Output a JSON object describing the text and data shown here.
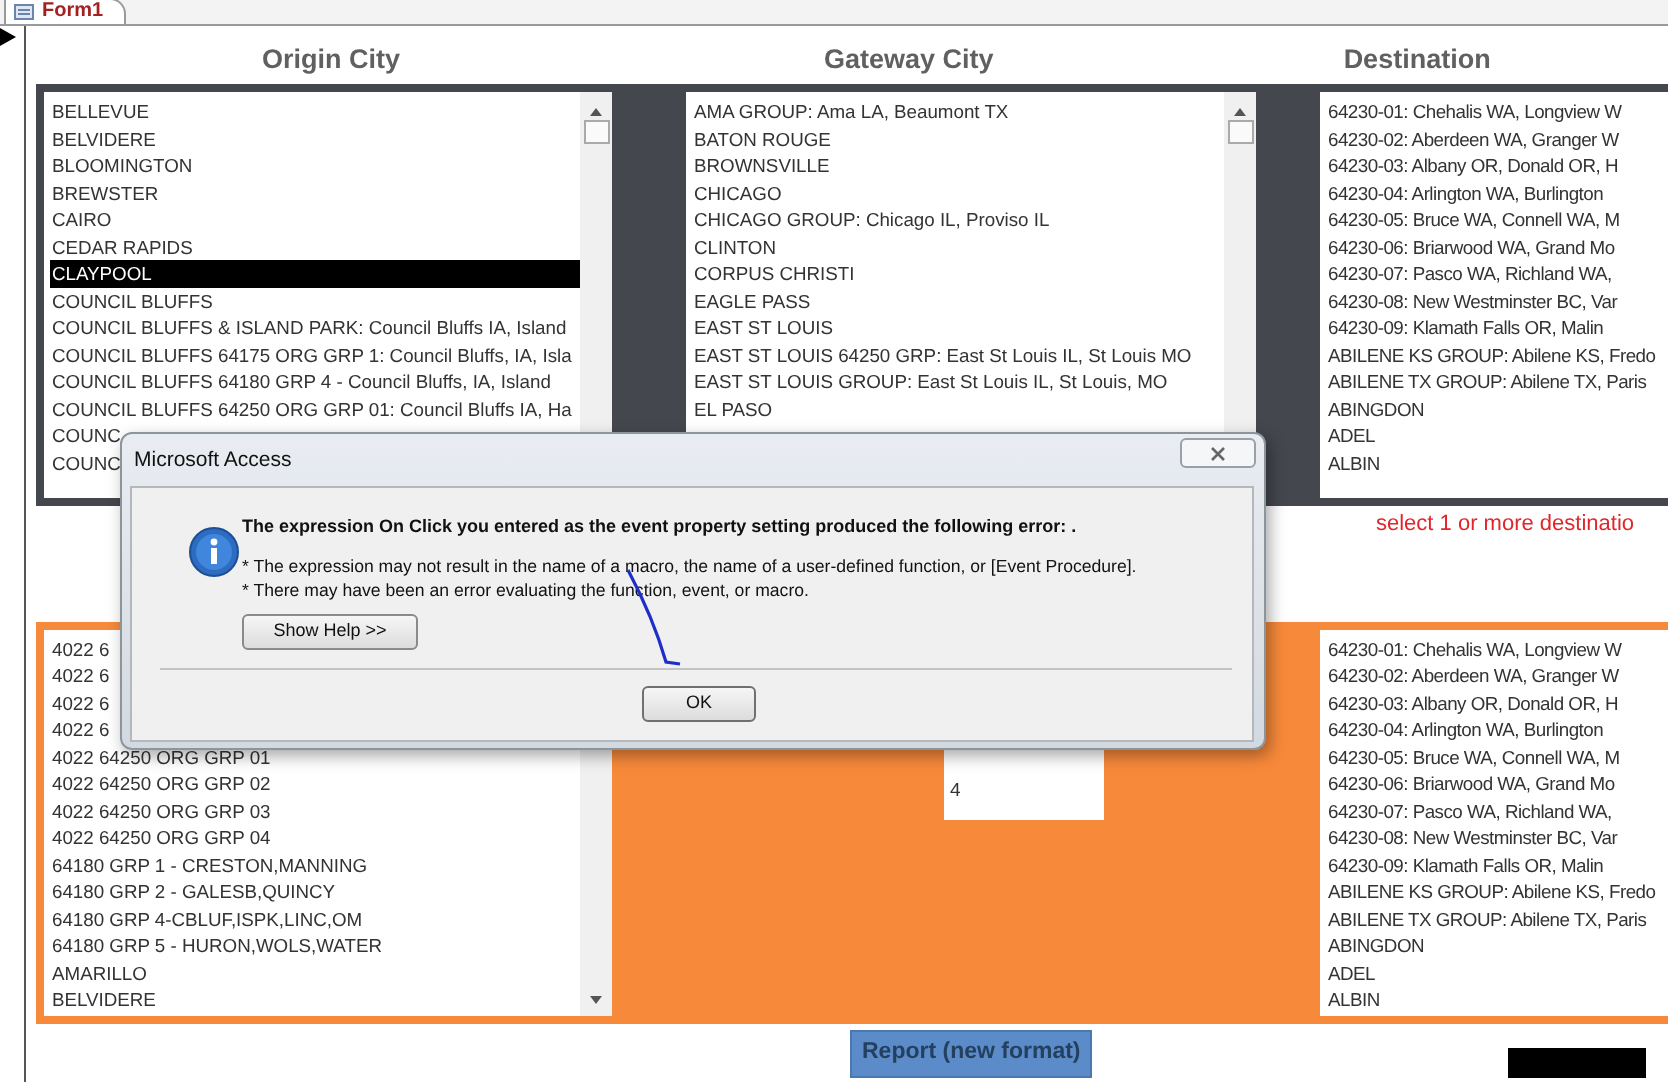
{
  "tab": {
    "label": "Form1"
  },
  "headers": [
    "Origin City",
    "Gateway City",
    "Destination"
  ],
  "origin_list": {
    "items": [
      {
        "text": "BELLEVUE",
        "selected": false
      },
      {
        "text": "BELVIDERE",
        "selected": false
      },
      {
        "text": "BLOOMINGTON",
        "selected": false
      },
      {
        "text": "BREWSTER",
        "selected": false
      },
      {
        "text": "CAIRO",
        "selected": false
      },
      {
        "text": "CEDAR RAPIDS",
        "selected": false
      },
      {
        "text": "CLAYPOOL",
        "selected": true
      },
      {
        "text": "COUNCIL BLUFFS",
        "selected": false
      },
      {
        "text": "COUNCIL BLUFFS & ISLAND PARK: Council Bluffs IA, Island",
        "selected": false
      },
      {
        "text": "COUNCIL BLUFFS 64175 ORG GRP 1: Council Bluffs, IA, Isla",
        "selected": false
      },
      {
        "text": "COUNCIL BLUFFS 64180 GRP 4 - Council Bluffs, IA, Island",
        "selected": false
      },
      {
        "text": "COUNCIL BLUFFS 64250 ORG GRP 01: Council Bluffs IA, Ha",
        "selected": false
      },
      {
        "text": "COUNC",
        "selected": false
      },
      {
        "text": "COUNC",
        "selected": false
      }
    ]
  },
  "gateway_list": {
    "items": [
      {
        "text": "AMA GROUP: Ama LA, Beaumont TX",
        "selected": false
      },
      {
        "text": "BATON ROUGE",
        "selected": false
      },
      {
        "text": "BROWNSVILLE",
        "selected": false
      },
      {
        "text": "CHICAGO",
        "selected": false
      },
      {
        "text": "CHICAGO GROUP: Chicago IL, Proviso IL",
        "selected": false
      },
      {
        "text": "CLINTON",
        "selected": false
      },
      {
        "text": "CORPUS CHRISTI",
        "selected": false
      },
      {
        "text": "EAGLE PASS",
        "selected": false
      },
      {
        "text": "EAST ST LOUIS",
        "selected": false
      },
      {
        "text": "EAST ST LOUIS 64250 GRP: East St Louis IL, St Louis MO",
        "selected": false
      },
      {
        "text": "EAST ST LOUIS GROUP: East St Louis IL, St Louis, MO",
        "selected": false
      },
      {
        "text": "EL PASO",
        "selected": false
      }
    ]
  },
  "destination_list": {
    "items": [
      {
        "text": "64230-01: Chehalis WA, Longview W",
        "selected": false
      },
      {
        "text": "64230-02: Aberdeen WA, Granger W",
        "selected": false
      },
      {
        "text": "64230-03: Albany OR, Donald OR, H",
        "selected": false
      },
      {
        "text": "64230-04: Arlington WA, Burlington",
        "selected": false
      },
      {
        "text": "64230-05: Bruce WA, Connell WA, M",
        "selected": false
      },
      {
        "text": "64230-06: Briarwood WA, Grand Mo",
        "selected": false
      },
      {
        "text": "64230-07: Pasco WA, Richland WA,",
        "selected": false
      },
      {
        "text": "64230-08: New Westminster BC, Var",
        "selected": false
      },
      {
        "text": "64230-09: Klamath Falls OR, Malin",
        "selected": false
      },
      {
        "text": "ABILENE KS GROUP: Abilene KS, Fredo",
        "selected": false
      },
      {
        "text": "ABILENE TX GROUP: Abilene TX, Paris",
        "selected": false
      },
      {
        "text": "ABINGDON",
        "selected": false
      },
      {
        "text": "ADEL",
        "selected": false
      },
      {
        "text": "ALBIN",
        "selected": false
      }
    ]
  },
  "hint": "select 1 or more destinatio",
  "bottom_left_list": {
    "items": [
      {
        "text": "4022 6",
        "selected": false
      },
      {
        "text": "4022 6",
        "selected": false
      },
      {
        "text": "4022 6",
        "selected": false
      },
      {
        "text": "4022 6",
        "selected": false
      },
      {
        "text": "4022 64250 ORG GRP 01",
        "selected": false
      },
      {
        "text": "4022 64250 ORG GRP 02",
        "selected": false
      },
      {
        "text": "4022 64250 ORG GRP 03",
        "selected": false
      },
      {
        "text": "4022 64250 ORG GRP 04",
        "selected": false
      },
      {
        "text": "64180 GRP 1 - CRESTON,MANNING",
        "selected": false
      },
      {
        "text": "64180 GRP 2 - GALESB,QUINCY",
        "selected": false
      },
      {
        "text": "64180 GRP 4-CBLUF,ISPK,LINC,OM",
        "selected": false
      },
      {
        "text": "64180 GRP 5 - HURON,WOLS,WATER",
        "selected": false
      },
      {
        "text": "AMARILLO",
        "selected": false
      },
      {
        "text": "BELVIDERE",
        "selected": false
      }
    ]
  },
  "number_box": {
    "items": [
      "4"
    ]
  },
  "bottom_right_list": {
    "items": [
      {
        "text": "64230-01: Chehalis WA, Longview W",
        "selected": false
      },
      {
        "text": "64230-02: Aberdeen WA, Granger W",
        "selected": false
      },
      {
        "text": "64230-03: Albany OR, Donald OR, H",
        "selected": false
      },
      {
        "text": "64230-04: Arlington WA, Burlington",
        "selected": false
      },
      {
        "text": "64230-05: Bruce WA, Connell WA, M",
        "selected": false
      },
      {
        "text": "64230-06: Briarwood WA, Grand Mo",
        "selected": false
      },
      {
        "text": "64230-07: Pasco WA, Richland WA,",
        "selected": false
      },
      {
        "text": "64230-08: New Westminster BC, Var",
        "selected": false
      },
      {
        "text": "64230-09: Klamath Falls OR, Malin",
        "selected": false
      },
      {
        "text": "ABILENE KS GROUP: Abilene KS, Fredo",
        "selected": false
      },
      {
        "text": "ABILENE TX GROUP: Abilene TX, Paris",
        "selected": false
      },
      {
        "text": "ABINGDON",
        "selected": false
      },
      {
        "text": "ADEL",
        "selected": false
      },
      {
        "text": "ALBIN",
        "selected": false
      }
    ]
  },
  "report_button": "Report (new format)",
  "dialog": {
    "title": "Microsoft Access",
    "heading": "The expression On Click you entered as the event property setting produced the following error: .",
    "bullets": [
      "* The expression may not result in the name of a macro, the name of a user-defined function, or [Event Procedure].",
      "* There may have been an error evaluating the function, event, or macro."
    ],
    "help_button": "Show Help >>",
    "ok_button": "OK"
  }
}
